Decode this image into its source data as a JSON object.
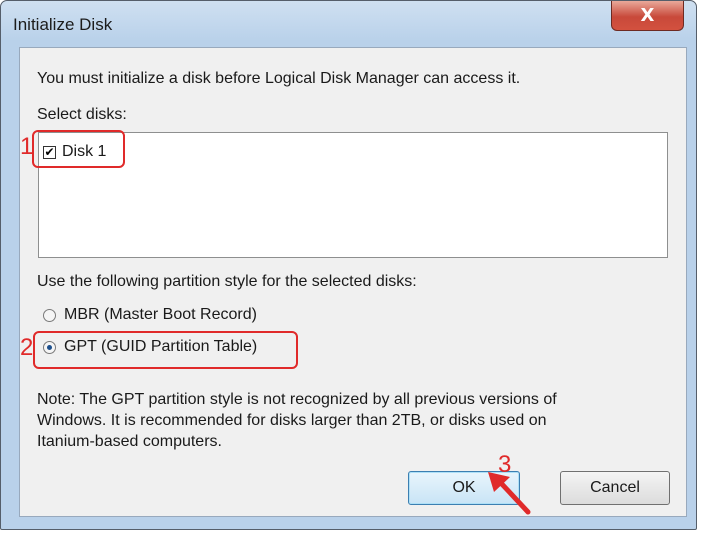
{
  "window": {
    "title": "Initialize Disk",
    "close_label": "X"
  },
  "intro_text": "You must initialize a disk before Logical Disk Manager can access it.",
  "select_disks_label": "Select disks:",
  "disks": [
    {
      "label": "Disk 1",
      "checked": true
    }
  ],
  "partition_prompt": "Use the following partition style for the selected disks:",
  "partition_options": [
    {
      "label": "MBR (Master Boot Record)",
      "selected": false
    },
    {
      "label": "GPT (GUID Partition Table)",
      "selected": true
    }
  ],
  "note_lines": [
    "Note: The GPT partition style is not recognized by all previous versions of",
    "Windows. It is recommended for disks larger than 2TB, or disks used on",
    "Itanium-based computers."
  ],
  "buttons": {
    "ok": "OK",
    "cancel": "Cancel"
  },
  "annotations": {
    "step1": "1",
    "step2": "2",
    "step3": "3",
    "color": "#e02a2a"
  }
}
